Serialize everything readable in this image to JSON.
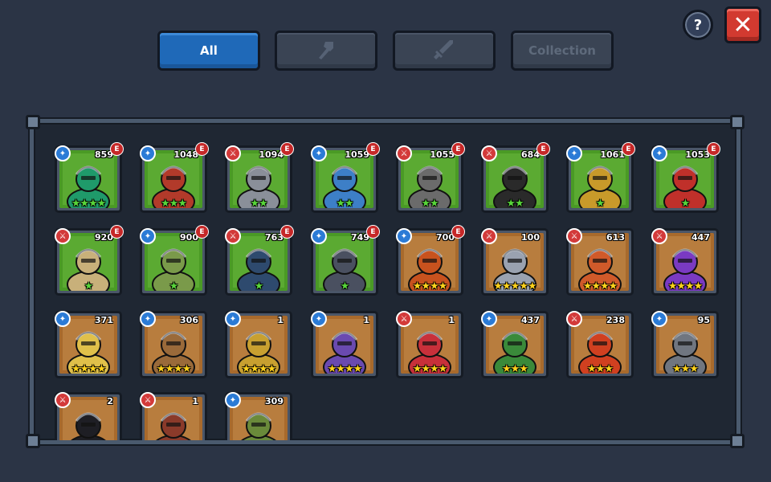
{
  "tabs": [
    {
      "label": "All",
      "icon": null,
      "active": true
    },
    {
      "label": "",
      "icon": "magic-staff-icon",
      "active": false
    },
    {
      "label": "",
      "icon": "sword-icon",
      "active": false
    },
    {
      "label": "Collection",
      "icon": null,
      "active": false
    }
  ],
  "help": {
    "label": "?"
  },
  "close": {
    "label": "✕"
  },
  "colors": {
    "background": "#2b3445",
    "tab_active": "#1f69b8",
    "rarity_epic": "#4a9a25",
    "rarity_common": "#a86a2c",
    "type_magic": "#2b7bd6",
    "type_melee": "#d33a3a"
  },
  "heroes": [
    {
      "power": "859",
      "type": "magic",
      "epic": true,
      "stars": 4,
      "frame": "green",
      "hue": "#1f9a6a"
    },
    {
      "power": "1048",
      "type": "magic",
      "epic": true,
      "stars": 3,
      "frame": "green",
      "hue": "#b23a2a"
    },
    {
      "power": "1094",
      "type": "melee",
      "epic": true,
      "stars": 2,
      "frame": "green",
      "hue": "#8a8f99"
    },
    {
      "power": "1059",
      "type": "magic",
      "epic": true,
      "stars": 2,
      "frame": "green",
      "hue": "#3d7fc7"
    },
    {
      "power": "1055",
      "type": "melee",
      "epic": true,
      "stars": 2,
      "frame": "green",
      "hue": "#6b6b6b"
    },
    {
      "power": "684",
      "type": "melee",
      "epic": true,
      "stars": 2,
      "frame": "green",
      "hue": "#2a2a2a"
    },
    {
      "power": "1061",
      "type": "magic",
      "epic": true,
      "stars": 1,
      "frame": "green",
      "hue": "#c89a2a"
    },
    {
      "power": "1053",
      "type": "magic",
      "epic": true,
      "stars": 1,
      "frame": "green",
      "hue": "#c0302a"
    },
    {
      "power": "920",
      "type": "melee",
      "epic": true,
      "stars": 1,
      "frame": "green",
      "hue": "#c8b07a"
    },
    {
      "power": "900",
      "type": "magic",
      "epic": true,
      "stars": 1,
      "frame": "green",
      "hue": "#7a9a4a"
    },
    {
      "power": "763",
      "type": "melee",
      "epic": true,
      "stars": 1,
      "frame": "green",
      "hue": "#2e4a6e"
    },
    {
      "power": "749",
      "type": "magic",
      "epic": true,
      "stars": 1,
      "frame": "green",
      "hue": "#4a5060"
    },
    {
      "power": "700",
      "type": "magic",
      "epic": true,
      "stars": 4,
      "frame": "brown",
      "hue": "#c8521e"
    },
    {
      "power": "100",
      "type": "melee",
      "epic": false,
      "stars": 5,
      "frame": "brown",
      "hue": "#9aa2b0"
    },
    {
      "power": "613",
      "type": "melee",
      "epic": false,
      "stars": 4,
      "frame": "brown",
      "hue": "#d05a2a"
    },
    {
      "power": "447",
      "type": "melee",
      "epic": false,
      "stars": 4,
      "frame": "brown",
      "hue": "#7a3ac2"
    },
    {
      "power": "371",
      "type": "magic",
      "epic": false,
      "stars": 4,
      "frame": "brown",
      "hue": "#e0c04a"
    },
    {
      "power": "306",
      "type": "magic",
      "epic": false,
      "stars": 4,
      "frame": "brown",
      "hue": "#9a6a3a"
    },
    {
      "power": "1",
      "type": "magic",
      "epic": false,
      "stars": 4,
      "frame": "brown",
      "hue": "#c8a030"
    },
    {
      "power": "1",
      "type": "magic",
      "epic": false,
      "stars": 4,
      "frame": "brown",
      "hue": "#6a4ab0"
    },
    {
      "power": "1",
      "type": "melee",
      "epic": false,
      "stars": 4,
      "frame": "brown",
      "hue": "#c8303a"
    },
    {
      "power": "437",
      "type": "magic",
      "epic": false,
      "stars": 3,
      "frame": "brown",
      "hue": "#3a8a3a"
    },
    {
      "power": "238",
      "type": "melee",
      "epic": false,
      "stars": 3,
      "frame": "brown",
      "hue": "#d04020"
    },
    {
      "power": "95",
      "type": "magic",
      "epic": false,
      "stars": 3,
      "frame": "brown",
      "hue": "#707680"
    },
    {
      "power": "2",
      "type": "melee",
      "epic": false,
      "stars": 0,
      "frame": "brown",
      "hue": "#1e1e24"
    },
    {
      "power": "1",
      "type": "melee",
      "epic": false,
      "stars": 0,
      "frame": "brown",
      "hue": "#8a3a2a"
    },
    {
      "power": "309",
      "type": "magic",
      "epic": false,
      "stars": 0,
      "frame": "brown",
      "hue": "#6a8a3a"
    }
  ]
}
